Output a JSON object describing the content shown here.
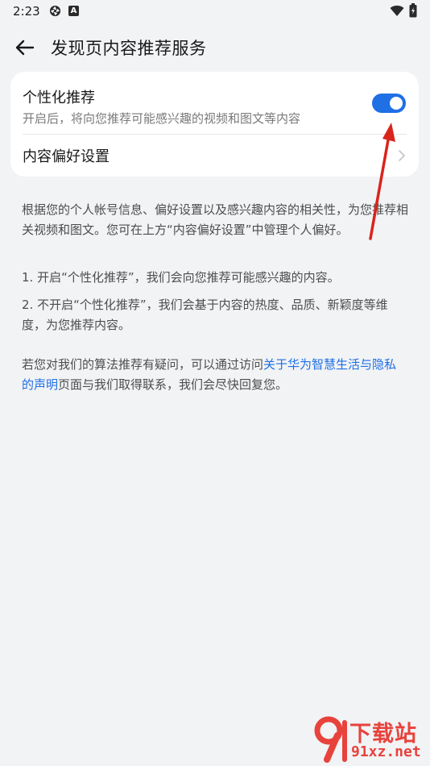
{
  "status_bar": {
    "time": "2:23",
    "badge_letter": "A"
  },
  "header": {
    "title": "发现页内容推荐服务"
  },
  "settings": {
    "personalized": {
      "title": "个性化推荐",
      "subtitle": "开启后，将向您推荐可能感兴趣的视频和图文等内容",
      "enabled": true
    },
    "preference_label": "内容偏好设置"
  },
  "description": {
    "paragraph1": "根据您的个人帐号信息、偏好设置以及感兴趣内容的相关性，为您推荐相关视频和图文。您可在上方“内容偏好设置”中管理个人偏好。",
    "item1": "1. 开启“个性化推荐”，我们会向您推荐可能感兴趣的内容。",
    "item2": "2. 不开启“个性化推荐”，我们会基于内容的热度、品质、新颖度等维度，为您推荐内容。",
    "contact_prefix": "若您对我们的算法推荐有疑问，可以通过访问",
    "contact_link": "关于华为智慧生活与隐私的声明",
    "contact_suffix": "页面与我们取得联系，我们会尽快回复您。"
  },
  "watermark": {
    "line1": "下载站",
    "line2": "91xz.net"
  },
  "colors": {
    "accent": "#1f6fe5",
    "background": "#f1f3f5",
    "annotation": "#d9241c",
    "watermark": "#e8423c"
  }
}
